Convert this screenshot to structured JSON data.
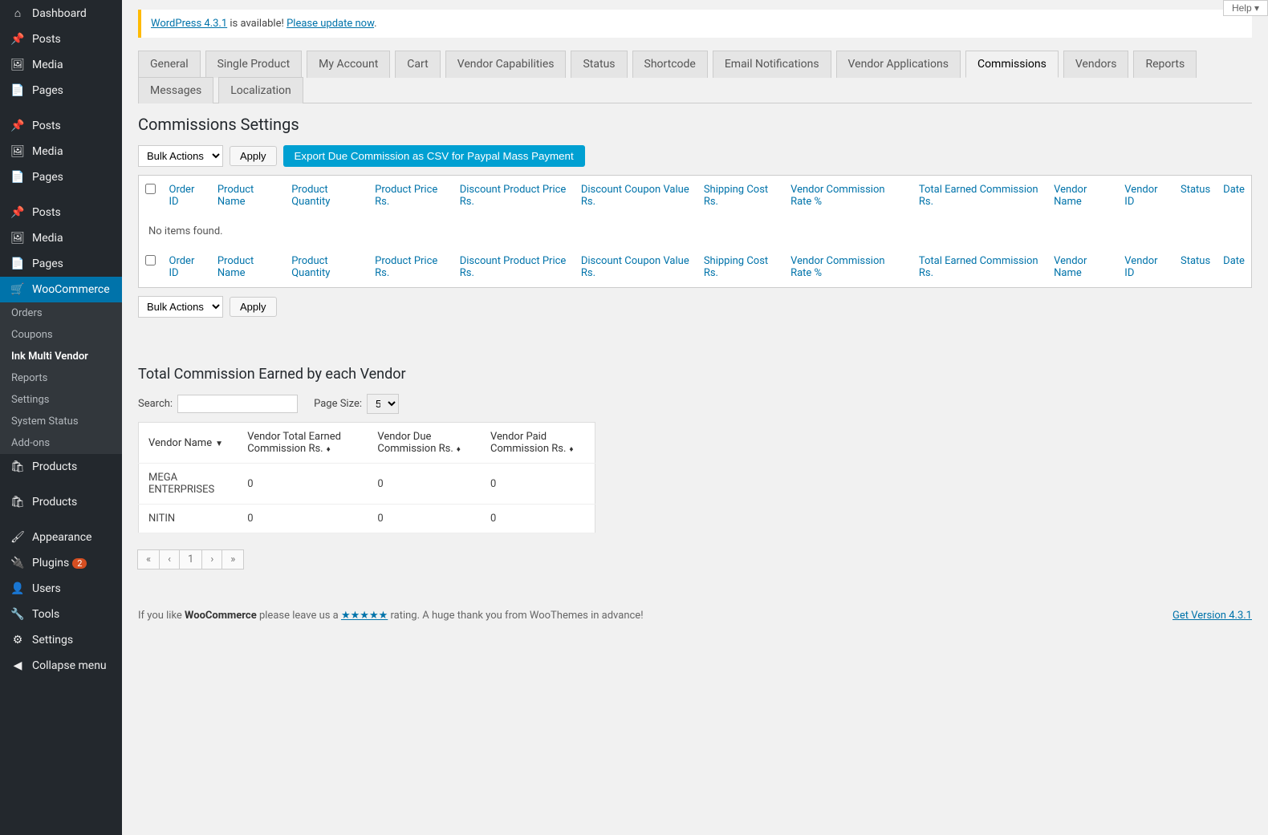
{
  "help_button": "Help ▾",
  "notice": {
    "link1": "WordPress 4.3.1",
    "text1": " is available! ",
    "link2": "Please update now",
    "text2": "."
  },
  "sidebar": {
    "groups": [
      [
        {
          "icon": "⌂",
          "label": "Dashboard"
        },
        {
          "icon": "✎",
          "label": "Posts"
        },
        {
          "icon": "🖼",
          "label": "Media"
        },
        {
          "icon": "📄",
          "label": "Pages"
        }
      ],
      [
        {
          "icon": "✎",
          "label": "Posts"
        },
        {
          "icon": "🖼",
          "label": "Media"
        },
        {
          "icon": "📄",
          "label": "Pages"
        }
      ],
      [
        {
          "icon": "✎",
          "label": "Posts"
        },
        {
          "icon": "🖼",
          "label": "Media"
        },
        {
          "icon": "📄",
          "label": "Pages"
        }
      ]
    ],
    "woo": {
      "label": "WooCommerce"
    },
    "woo_sub": [
      "Orders",
      "Coupons",
      "Ink Multi Vendor",
      "Reports",
      "Settings",
      "System Status",
      "Add-ons"
    ],
    "after": [
      {
        "icon": "🛍",
        "label": "Products"
      },
      {
        "icon": "🛍",
        "label": "Products"
      },
      {
        "icon": "✎",
        "label": "Appearance"
      },
      {
        "icon": "🔌",
        "label": "Plugins",
        "badge": "2"
      },
      {
        "icon": "👤",
        "label": "Users"
      },
      {
        "icon": "🔧",
        "label": "Tools"
      },
      {
        "icon": "⚙",
        "label": "Settings"
      }
    ],
    "collapse": {
      "icon": "◀",
      "label": "Collapse menu"
    }
  },
  "tabs_row1": [
    "General",
    "Single Product",
    "My Account",
    "Cart",
    "Vendor Capabilities",
    "Status",
    "Shortcode",
    "Email Notifications",
    "Vendor Applications",
    "Commissions"
  ],
  "tabs_row2": [
    "Vendors",
    "Reports",
    "Messages",
    "Localization"
  ],
  "active_tab": "Commissions",
  "section_title": "Commissions Settings",
  "bulk_actions_label": "Bulk Actions",
  "apply_label": "Apply",
  "export_label": "Export Due Commission as CSV for Paypal Mass Payment",
  "table": {
    "headers": [
      "Order ID",
      "Product Name",
      "Product Quantity",
      "Product Price Rs.",
      "Discount Product Price Rs.",
      "Discount Coupon Value Rs.",
      "Shipping Cost Rs.",
      "Vendor Commission Rate %",
      "Total Earned Commission Rs.",
      "Vendor Name",
      "Vendor ID",
      "Status",
      "Date"
    ],
    "no_items": "No items found."
  },
  "vendor_section_title": "Total Commission Earned by each Vendor",
  "search_label": "Search:",
  "page_size_label": "Page Size:",
  "page_size_value": "5",
  "vendor_table": {
    "headers": [
      "Vendor Name",
      "Vendor Total Earned Commission Rs.",
      "Vendor Due Commission Rs.",
      "Vendor Paid Commission Rs."
    ],
    "rows": [
      {
        "name": "MEGA ENTERPRISES",
        "total": "0",
        "due": "0",
        "paid": "0"
      },
      {
        "name": "NITIN",
        "total": "0",
        "due": "0",
        "paid": "0"
      }
    ]
  },
  "pagination": [
    "«",
    "‹",
    "1",
    "›",
    "»"
  ],
  "footer": {
    "pre": "If you like ",
    "woo": "WooCommerce",
    "mid": " please leave us a ",
    "stars": "★★★★★",
    "post": " rating. A huge thank you from WooThemes in advance!",
    "version_link": "Get Version 4.3.1"
  }
}
